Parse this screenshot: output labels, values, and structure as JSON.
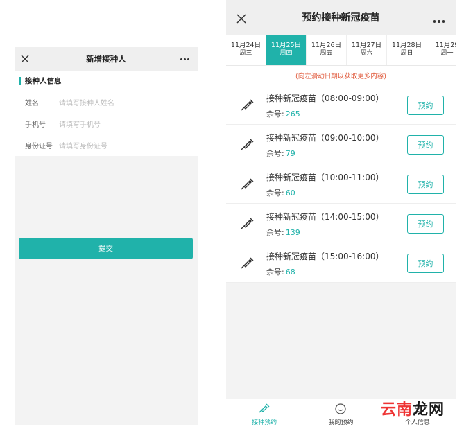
{
  "left": {
    "title": "新增接种人",
    "section": "接种人信息",
    "fields": [
      {
        "label": "姓名",
        "placeholder": "请填写接种人姓名"
      },
      {
        "label": "手机号",
        "placeholder": "请填写手机号"
      },
      {
        "label": "身份证号",
        "placeholder": "请填写身份证号"
      }
    ],
    "submit": "提交"
  },
  "right": {
    "title": "预约接种新冠疫苗",
    "dates": [
      {
        "date": "11月24日",
        "weekday": "周三"
      },
      {
        "date": "11月25日",
        "weekday": "周四"
      },
      {
        "date": "11月26日",
        "weekday": "周五"
      },
      {
        "date": "11月27日",
        "weekday": "周六"
      },
      {
        "date": "11月28日",
        "weekday": "周日"
      },
      {
        "date": "11月29",
        "weekday": "周一"
      }
    ],
    "active_date": "11月25日",
    "hint": "(向左滑动日期以获取更多内容)",
    "remain_label": "余号:",
    "book_label": "预约",
    "slots": [
      {
        "title": "接种新冠疫苗（08:00-09:00）",
        "remain": "265"
      },
      {
        "title": "接种新冠疫苗（09:00-10:00）",
        "remain": "79"
      },
      {
        "title": "接种新冠疫苗（10:00-11:00）",
        "remain": "60"
      },
      {
        "title": "接种新冠疫苗（14:00-15:00）",
        "remain": "139"
      },
      {
        "title": "接种新冠疫苗（15:00-16:00）",
        "remain": "68"
      }
    ],
    "tabs": [
      {
        "label": "接种预约",
        "icon": "syringe-icon"
      },
      {
        "label": "我的预约",
        "icon": "face-icon"
      },
      {
        "label": "个人信息",
        "icon": "person-icon"
      }
    ],
    "watermark": {
      "part1": "云南",
      "part2": "龙网"
    }
  },
  "colors": {
    "accent": "#20b2aa",
    "hint": "#e05a3c"
  }
}
